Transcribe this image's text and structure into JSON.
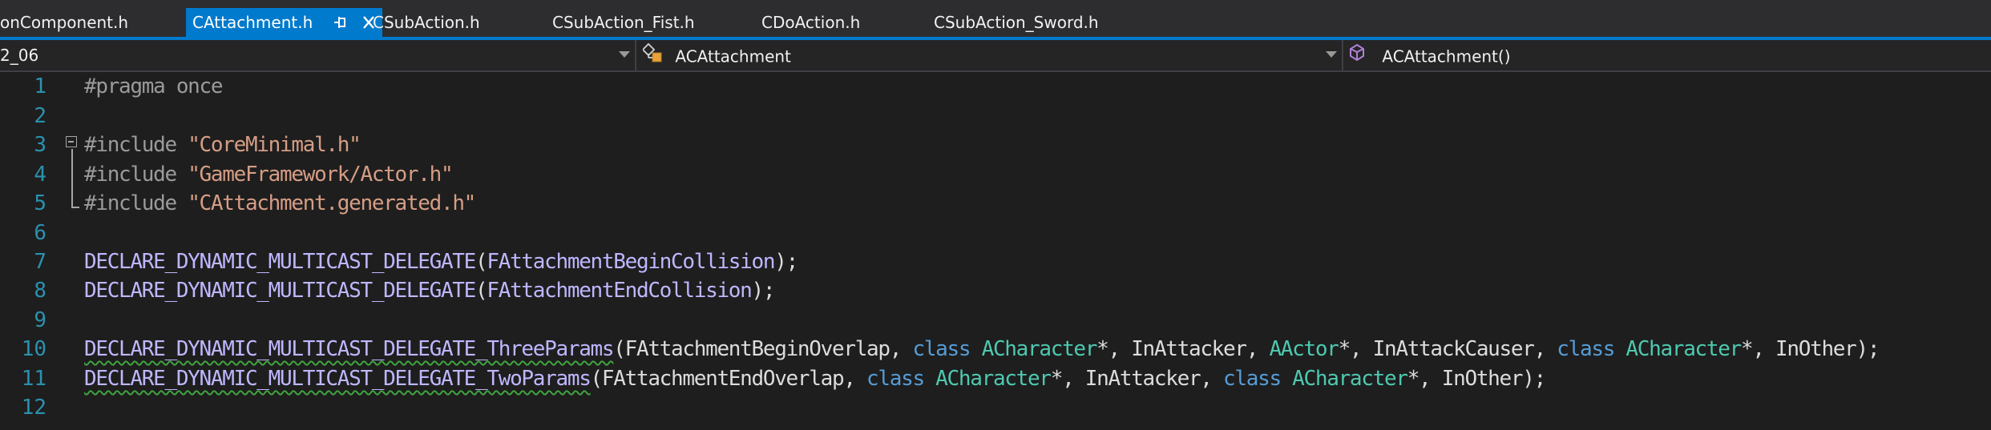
{
  "tabs": [
    {
      "label": "onComponent.h",
      "active": false
    },
    {
      "label": "CAttachment.h",
      "active": true
    },
    {
      "label": "CSubAction.h",
      "active": false
    },
    {
      "label": "CSubAction_Fist.h",
      "active": false
    },
    {
      "label": "CDoAction.h",
      "active": false
    },
    {
      "label": "CSubAction_Sword.h",
      "active": false
    }
  ],
  "navbar": {
    "project": "2_06",
    "scope": "ACAttachment",
    "member": "ACAttachment()"
  },
  "colors": {
    "accent": "#007acc",
    "background": "#1e1e1e",
    "line_number": "#2b91af",
    "preprocessor": "#9b9b9b",
    "string": "#d69d85",
    "macro": "#beb7ff",
    "keyword": "#569cd6",
    "type": "#4ec9b0",
    "squiggle": "#3fa33f"
  },
  "editor": {
    "lines": [
      {
        "num": "1",
        "tokens": [
          {
            "c": "pp",
            "t": "#pragma once"
          }
        ]
      },
      {
        "num": "2",
        "tokens": []
      },
      {
        "num": "3",
        "tokens": [
          {
            "c": "pp",
            "t": "#include "
          },
          {
            "c": "str",
            "t": "\"CoreMinimal.h\""
          }
        ]
      },
      {
        "num": "4",
        "tokens": [
          {
            "c": "pp",
            "t": "#include "
          },
          {
            "c": "str",
            "t": "\"GameFramework/Actor.h\""
          }
        ]
      },
      {
        "num": "5",
        "tokens": [
          {
            "c": "pp",
            "t": "#include "
          },
          {
            "c": "str",
            "t": "\"CAttachment.generated.h\""
          }
        ]
      },
      {
        "num": "6",
        "tokens": []
      },
      {
        "num": "7",
        "tokens": [
          {
            "c": "mac",
            "t": "DECLARE_DYNAMIC_MULTICAST_DELEGATE"
          },
          {
            "c": "pl",
            "t": "("
          },
          {
            "c": "mac",
            "t": "FAttachmentBeginCollision"
          },
          {
            "c": "pl",
            "t": ");"
          }
        ]
      },
      {
        "num": "8",
        "tokens": [
          {
            "c": "mac",
            "t": "DECLARE_DYNAMIC_MULTICAST_DELEGATE"
          },
          {
            "c": "pl",
            "t": "("
          },
          {
            "c": "mac",
            "t": "FAttachmentEndCollision"
          },
          {
            "c": "pl",
            "t": ");"
          }
        ]
      },
      {
        "num": "9",
        "tokens": []
      },
      {
        "num": "10",
        "tokens": [
          {
            "c": "mac squig",
            "t": "DECLARE_DYNAMIC_MULTICAST_DELEGATE_ThreeParams"
          },
          {
            "c": "pl",
            "t": "("
          },
          {
            "c": "pl",
            "t": "FAttachmentBeginOverlap, "
          },
          {
            "c": "kw",
            "t": "class "
          },
          {
            "c": "ty",
            "t": "ACharacter"
          },
          {
            "c": "pl",
            "t": "*, InAttacker, "
          },
          {
            "c": "ty",
            "t": "AActor"
          },
          {
            "c": "pl",
            "t": "*, InAttackCauser, "
          },
          {
            "c": "kw",
            "t": "class "
          },
          {
            "c": "ty",
            "t": "ACharacter"
          },
          {
            "c": "pl",
            "t": "*, InOther);"
          }
        ]
      },
      {
        "num": "11",
        "tokens": [
          {
            "c": "mac squig",
            "t": "DECLARE_DYNAMIC_MULTICAST_DELEGATE_TwoParams"
          },
          {
            "c": "pl",
            "t": "("
          },
          {
            "c": "pl",
            "t": "FAttachmentEndOverlap, "
          },
          {
            "c": "kw",
            "t": "class "
          },
          {
            "c": "ty",
            "t": "ACharacter"
          },
          {
            "c": "pl",
            "t": "*, InAttacker, "
          },
          {
            "c": "kw",
            "t": "class "
          },
          {
            "c": "ty",
            "t": "ACharacter"
          },
          {
            "c": "pl",
            "t": "*, InOther);"
          }
        ]
      },
      {
        "num": "12",
        "tokens": []
      }
    ]
  }
}
